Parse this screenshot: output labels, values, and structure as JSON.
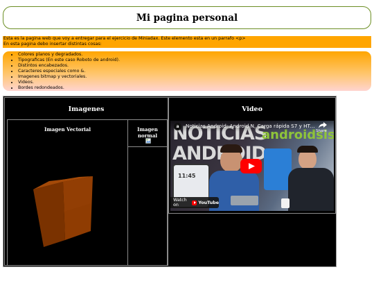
{
  "header": {
    "title": "Mi pagina personal"
  },
  "intro": {
    "line1": "Esta es la pagina web que voy a entregar para el ejercicio de Miniadax. Este elemento esta en un parrafo <p>",
    "line2": "En esta pagina debo insertar distintas cosas:"
  },
  "features": [
    "Colores planos y degradados.",
    "Tipograficas (En este caso Roboto de android).",
    "Distintos encabezados.",
    "Caracteres especiales como &.",
    "Imagenes bitmap y vectoriales.",
    "Videos.",
    "Bordes redondeados."
  ],
  "table": {
    "images_header": "Imagenes",
    "video_header": "Video",
    "vector_label": "Imagen Vectorial",
    "normal_label": "Imagen normal"
  },
  "video": {
    "title": "Noticias Android: Android N, Carga rápida S7 y HTC...",
    "share_label": "Share",
    "watch_on": "Watch on",
    "platform": "YouTube",
    "thumb_big_text_1": "NOTICIAS",
    "thumb_big_text_2": "ANDROID",
    "thumb_brand": "androidsis",
    "time": "11:45"
  },
  "colors": {
    "intro_bg": "#ffa500",
    "header_border": "#6b8e23",
    "cube_front": "#8b3a00",
    "cube_top": "#a54a08",
    "cube_side": "#6a2c00",
    "play_red": "#ff0000"
  },
  "icons": [
    "broken-image-icon",
    "share-icon",
    "play-icon",
    "youtube-logo-icon",
    "channel-logo-icon"
  ]
}
